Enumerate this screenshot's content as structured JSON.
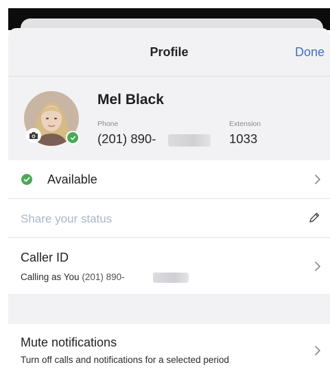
{
  "nav": {
    "title": "Profile",
    "done_label": "Done"
  },
  "profile": {
    "name": "Mel Black",
    "phone_label": "Phone",
    "phone_value": "(201) 890-",
    "extension_label": "Extension",
    "extension_value": "1033"
  },
  "status": {
    "label": "Available",
    "color": "#4aa955"
  },
  "share_status": {
    "placeholder": "Share your status"
  },
  "caller_id": {
    "title": "Caller ID",
    "subtitle_prefix": "Calling as You",
    "subtitle_number": "(201) 890-"
  },
  "mute": {
    "title": "Mute notifications",
    "subtitle": "Turn off calls and notifications for a selected period"
  },
  "colors": {
    "accent": "#3d6fc4",
    "available_green": "#4aa955",
    "placeholder": "#a9b6c8"
  },
  "icons": [
    "camera-icon",
    "check-icon",
    "chevron-right-icon",
    "pencil-icon"
  ]
}
